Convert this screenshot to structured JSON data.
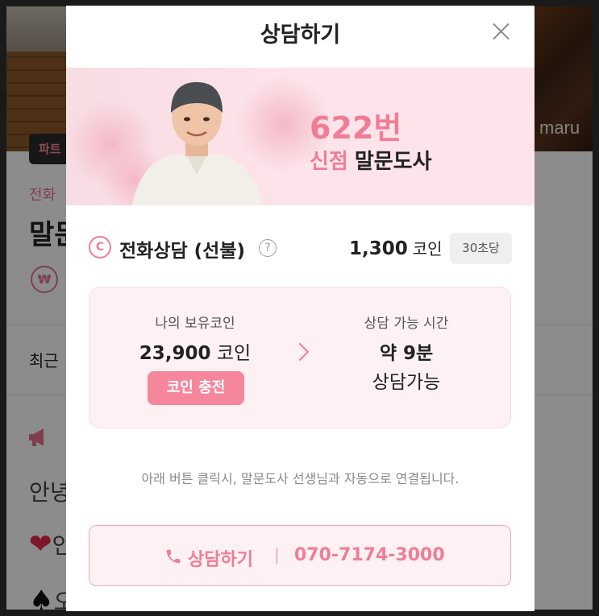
{
  "background": {
    "badge": "파트",
    "category": "전화",
    "name": "말문",
    "won_symbol": "₩",
    "recent": "최근",
    "megaphone_icon": "megaphone-icon",
    "text_line": "안녕",
    "line_heart": "인",
    "line_spade": "오",
    "photo_text": "maru"
  },
  "modal": {
    "title": "상담하기",
    "close_icon": "close-icon",
    "counselor": {
      "number": "622번",
      "tag": "신점",
      "name": "말문도사"
    },
    "service": {
      "coin_icon": "C",
      "title": "전화상담 (선불)",
      "help": "?",
      "price": "1,300",
      "price_unit": "코인",
      "per_unit": "30초당"
    },
    "wallet": {
      "label": "나의 보유코인",
      "amount": "23,900",
      "amount_unit": "코인",
      "charge_button": "코인 충전"
    },
    "availability": {
      "label": "상담 가능 시간",
      "time": "약 9분",
      "status": "상담가능"
    },
    "notice": "아래 버튼 클릭시, 말문도사 선생님과 자동으로 연결됩니다.",
    "call": {
      "label": "상담하기",
      "separator": "|",
      "number": "070-7174-3000"
    }
  },
  "colors": {
    "accent": "#f07d96",
    "button": "#f5869c",
    "hero_bg": "#fde4ea",
    "info_bg": "#fdf1f3"
  }
}
